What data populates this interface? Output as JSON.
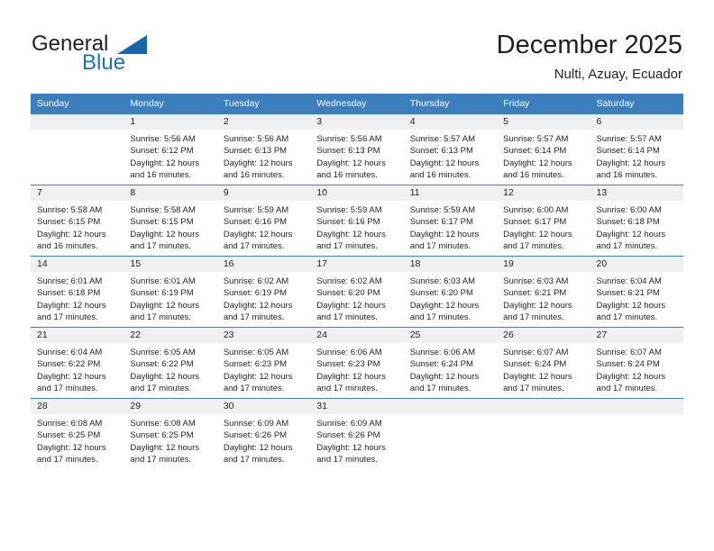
{
  "brand": {
    "word_one": "General",
    "word_two": "Blue",
    "triangle_icon": "triangle-icon"
  },
  "header": {
    "title": "December 2025",
    "subtitle": "Nulti, Azuay, Ecuador"
  },
  "calendar": {
    "weekday_headers": [
      "Sunday",
      "Monday",
      "Tuesday",
      "Wednesday",
      "Thursday",
      "Friday",
      "Saturday"
    ],
    "accent_color": "#3c7fbe",
    "daynum_band_color": "#f0f0f0",
    "weeks": [
      [
        {
          "day": "",
          "sunrise": "",
          "sunset": "",
          "daylight_1": "",
          "daylight_2": ""
        },
        {
          "day": "1",
          "sunrise": "Sunrise: 5:56 AM",
          "sunset": "Sunset: 6:12 PM",
          "daylight_1": "Daylight: 12 hours",
          "daylight_2": "and 16 minutes."
        },
        {
          "day": "2",
          "sunrise": "Sunrise: 5:56 AM",
          "sunset": "Sunset: 6:13 PM",
          "daylight_1": "Daylight: 12 hours",
          "daylight_2": "and 16 minutes."
        },
        {
          "day": "3",
          "sunrise": "Sunrise: 5:56 AM",
          "sunset": "Sunset: 6:13 PM",
          "daylight_1": "Daylight: 12 hours",
          "daylight_2": "and 16 minutes."
        },
        {
          "day": "4",
          "sunrise": "Sunrise: 5:57 AM",
          "sunset": "Sunset: 6:13 PM",
          "daylight_1": "Daylight: 12 hours",
          "daylight_2": "and 16 minutes."
        },
        {
          "day": "5",
          "sunrise": "Sunrise: 5:57 AM",
          "sunset": "Sunset: 6:14 PM",
          "daylight_1": "Daylight: 12 hours",
          "daylight_2": "and 16 minutes."
        },
        {
          "day": "6",
          "sunrise": "Sunrise: 5:57 AM",
          "sunset": "Sunset: 6:14 PM",
          "daylight_1": "Daylight: 12 hours",
          "daylight_2": "and 16 minutes."
        }
      ],
      [
        {
          "day": "7",
          "sunrise": "Sunrise: 5:58 AM",
          "sunset": "Sunset: 6:15 PM",
          "daylight_1": "Daylight: 12 hours",
          "daylight_2": "and 16 minutes."
        },
        {
          "day": "8",
          "sunrise": "Sunrise: 5:58 AM",
          "sunset": "Sunset: 6:15 PM",
          "daylight_1": "Daylight: 12 hours",
          "daylight_2": "and 17 minutes."
        },
        {
          "day": "9",
          "sunrise": "Sunrise: 5:59 AM",
          "sunset": "Sunset: 6:16 PM",
          "daylight_1": "Daylight: 12 hours",
          "daylight_2": "and 17 minutes."
        },
        {
          "day": "10",
          "sunrise": "Sunrise: 5:59 AM",
          "sunset": "Sunset: 6:16 PM",
          "daylight_1": "Daylight: 12 hours",
          "daylight_2": "and 17 minutes."
        },
        {
          "day": "11",
          "sunrise": "Sunrise: 5:59 AM",
          "sunset": "Sunset: 6:17 PM",
          "daylight_1": "Daylight: 12 hours",
          "daylight_2": "and 17 minutes."
        },
        {
          "day": "12",
          "sunrise": "Sunrise: 6:00 AM",
          "sunset": "Sunset: 6:17 PM",
          "daylight_1": "Daylight: 12 hours",
          "daylight_2": "and 17 minutes."
        },
        {
          "day": "13",
          "sunrise": "Sunrise: 6:00 AM",
          "sunset": "Sunset: 6:18 PM",
          "daylight_1": "Daylight: 12 hours",
          "daylight_2": "and 17 minutes."
        }
      ],
      [
        {
          "day": "14",
          "sunrise": "Sunrise: 6:01 AM",
          "sunset": "Sunset: 6:18 PM",
          "daylight_1": "Daylight: 12 hours",
          "daylight_2": "and 17 minutes."
        },
        {
          "day": "15",
          "sunrise": "Sunrise: 6:01 AM",
          "sunset": "Sunset: 6:19 PM",
          "daylight_1": "Daylight: 12 hours",
          "daylight_2": "and 17 minutes."
        },
        {
          "day": "16",
          "sunrise": "Sunrise: 6:02 AM",
          "sunset": "Sunset: 6:19 PM",
          "daylight_1": "Daylight: 12 hours",
          "daylight_2": "and 17 minutes."
        },
        {
          "day": "17",
          "sunrise": "Sunrise: 6:02 AM",
          "sunset": "Sunset: 6:20 PM",
          "daylight_1": "Daylight: 12 hours",
          "daylight_2": "and 17 minutes."
        },
        {
          "day": "18",
          "sunrise": "Sunrise: 6:03 AM",
          "sunset": "Sunset: 6:20 PM",
          "daylight_1": "Daylight: 12 hours",
          "daylight_2": "and 17 minutes."
        },
        {
          "day": "19",
          "sunrise": "Sunrise: 6:03 AM",
          "sunset": "Sunset: 6:21 PM",
          "daylight_1": "Daylight: 12 hours",
          "daylight_2": "and 17 minutes."
        },
        {
          "day": "20",
          "sunrise": "Sunrise: 6:04 AM",
          "sunset": "Sunset: 6:21 PM",
          "daylight_1": "Daylight: 12 hours",
          "daylight_2": "and 17 minutes."
        }
      ],
      [
        {
          "day": "21",
          "sunrise": "Sunrise: 6:04 AM",
          "sunset": "Sunset: 6:22 PM",
          "daylight_1": "Daylight: 12 hours",
          "daylight_2": "and 17 minutes."
        },
        {
          "day": "22",
          "sunrise": "Sunrise: 6:05 AM",
          "sunset": "Sunset: 6:22 PM",
          "daylight_1": "Daylight: 12 hours",
          "daylight_2": "and 17 minutes."
        },
        {
          "day": "23",
          "sunrise": "Sunrise: 6:05 AM",
          "sunset": "Sunset: 6:23 PM",
          "daylight_1": "Daylight: 12 hours",
          "daylight_2": "and 17 minutes."
        },
        {
          "day": "24",
          "sunrise": "Sunrise: 6:06 AM",
          "sunset": "Sunset: 6:23 PM",
          "daylight_1": "Daylight: 12 hours",
          "daylight_2": "and 17 minutes."
        },
        {
          "day": "25",
          "sunrise": "Sunrise: 6:06 AM",
          "sunset": "Sunset: 6:24 PM",
          "daylight_1": "Daylight: 12 hours",
          "daylight_2": "and 17 minutes."
        },
        {
          "day": "26",
          "sunrise": "Sunrise: 6:07 AM",
          "sunset": "Sunset: 6:24 PM",
          "daylight_1": "Daylight: 12 hours",
          "daylight_2": "and 17 minutes."
        },
        {
          "day": "27",
          "sunrise": "Sunrise: 6:07 AM",
          "sunset": "Sunset: 6:24 PM",
          "daylight_1": "Daylight: 12 hours",
          "daylight_2": "and 17 minutes."
        }
      ],
      [
        {
          "day": "28",
          "sunrise": "Sunrise: 6:08 AM",
          "sunset": "Sunset: 6:25 PM",
          "daylight_1": "Daylight: 12 hours",
          "daylight_2": "and 17 minutes."
        },
        {
          "day": "29",
          "sunrise": "Sunrise: 6:08 AM",
          "sunset": "Sunset: 6:25 PM",
          "daylight_1": "Daylight: 12 hours",
          "daylight_2": "and 17 minutes."
        },
        {
          "day": "30",
          "sunrise": "Sunrise: 6:09 AM",
          "sunset": "Sunset: 6:26 PM",
          "daylight_1": "Daylight: 12 hours",
          "daylight_2": "and 17 minutes."
        },
        {
          "day": "31",
          "sunrise": "Sunrise: 6:09 AM",
          "sunset": "Sunset: 6:26 PM",
          "daylight_1": "Daylight: 12 hours",
          "daylight_2": "and 17 minutes."
        },
        {
          "day": "",
          "sunrise": "",
          "sunset": "",
          "daylight_1": "",
          "daylight_2": ""
        },
        {
          "day": "",
          "sunrise": "",
          "sunset": "",
          "daylight_1": "",
          "daylight_2": ""
        },
        {
          "day": "",
          "sunrise": "",
          "sunset": "",
          "daylight_1": "",
          "daylight_2": ""
        }
      ]
    ]
  }
}
